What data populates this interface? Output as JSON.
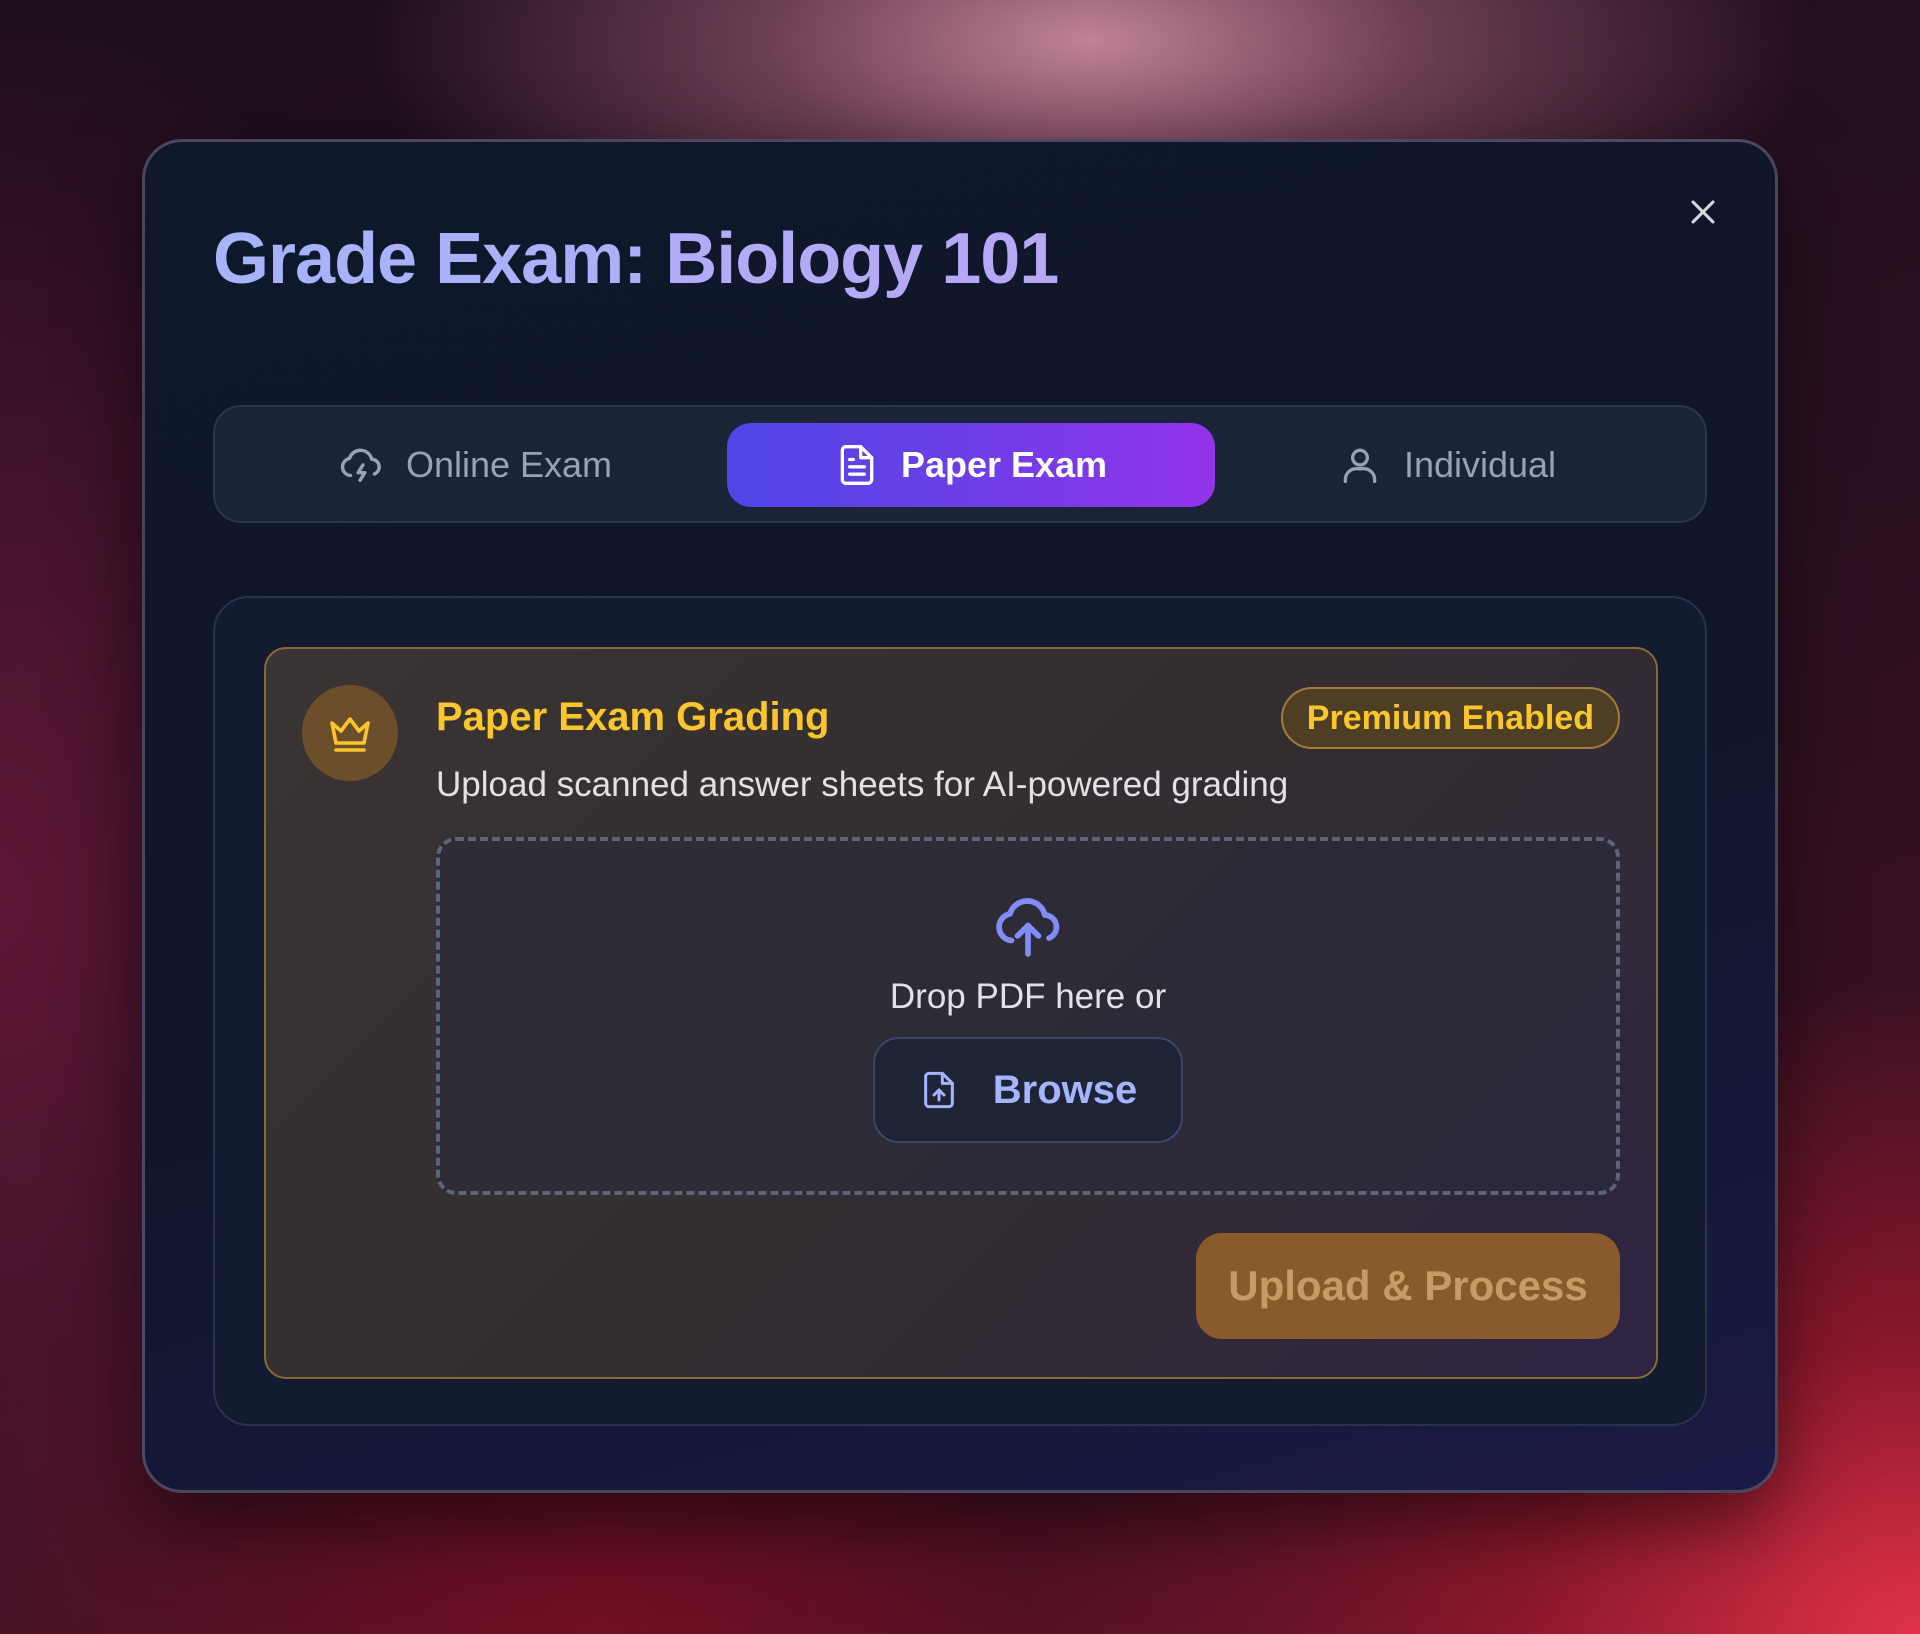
{
  "modal": {
    "title": "Grade Exam: Biology 101",
    "close_icon": "close-icon"
  },
  "tabs": [
    {
      "label": "Online Exam",
      "icon": "cloud-lightning-icon",
      "active": false
    },
    {
      "label": "Paper Exam",
      "icon": "document-icon",
      "active": true
    },
    {
      "label": "Individual",
      "icon": "user-icon",
      "active": false
    }
  ],
  "card": {
    "icon": "crown-icon",
    "title": "Paper Exam Grading",
    "badge": "Premium Enabled",
    "subtitle": "Upload scanned answer sheets for AI-powered grading",
    "dropzone": {
      "icon": "cloud-upload-icon",
      "text": "Drop PDF here or",
      "browse_label": "Browse",
      "browse_icon": "file-upload-icon"
    },
    "process_label": "Upload & Process"
  },
  "colors": {
    "accent_start": "#4f46e5",
    "accent_end": "#9333ea",
    "premium_gold": "#fcc52c",
    "title_lavender": "#a5b4fc"
  }
}
